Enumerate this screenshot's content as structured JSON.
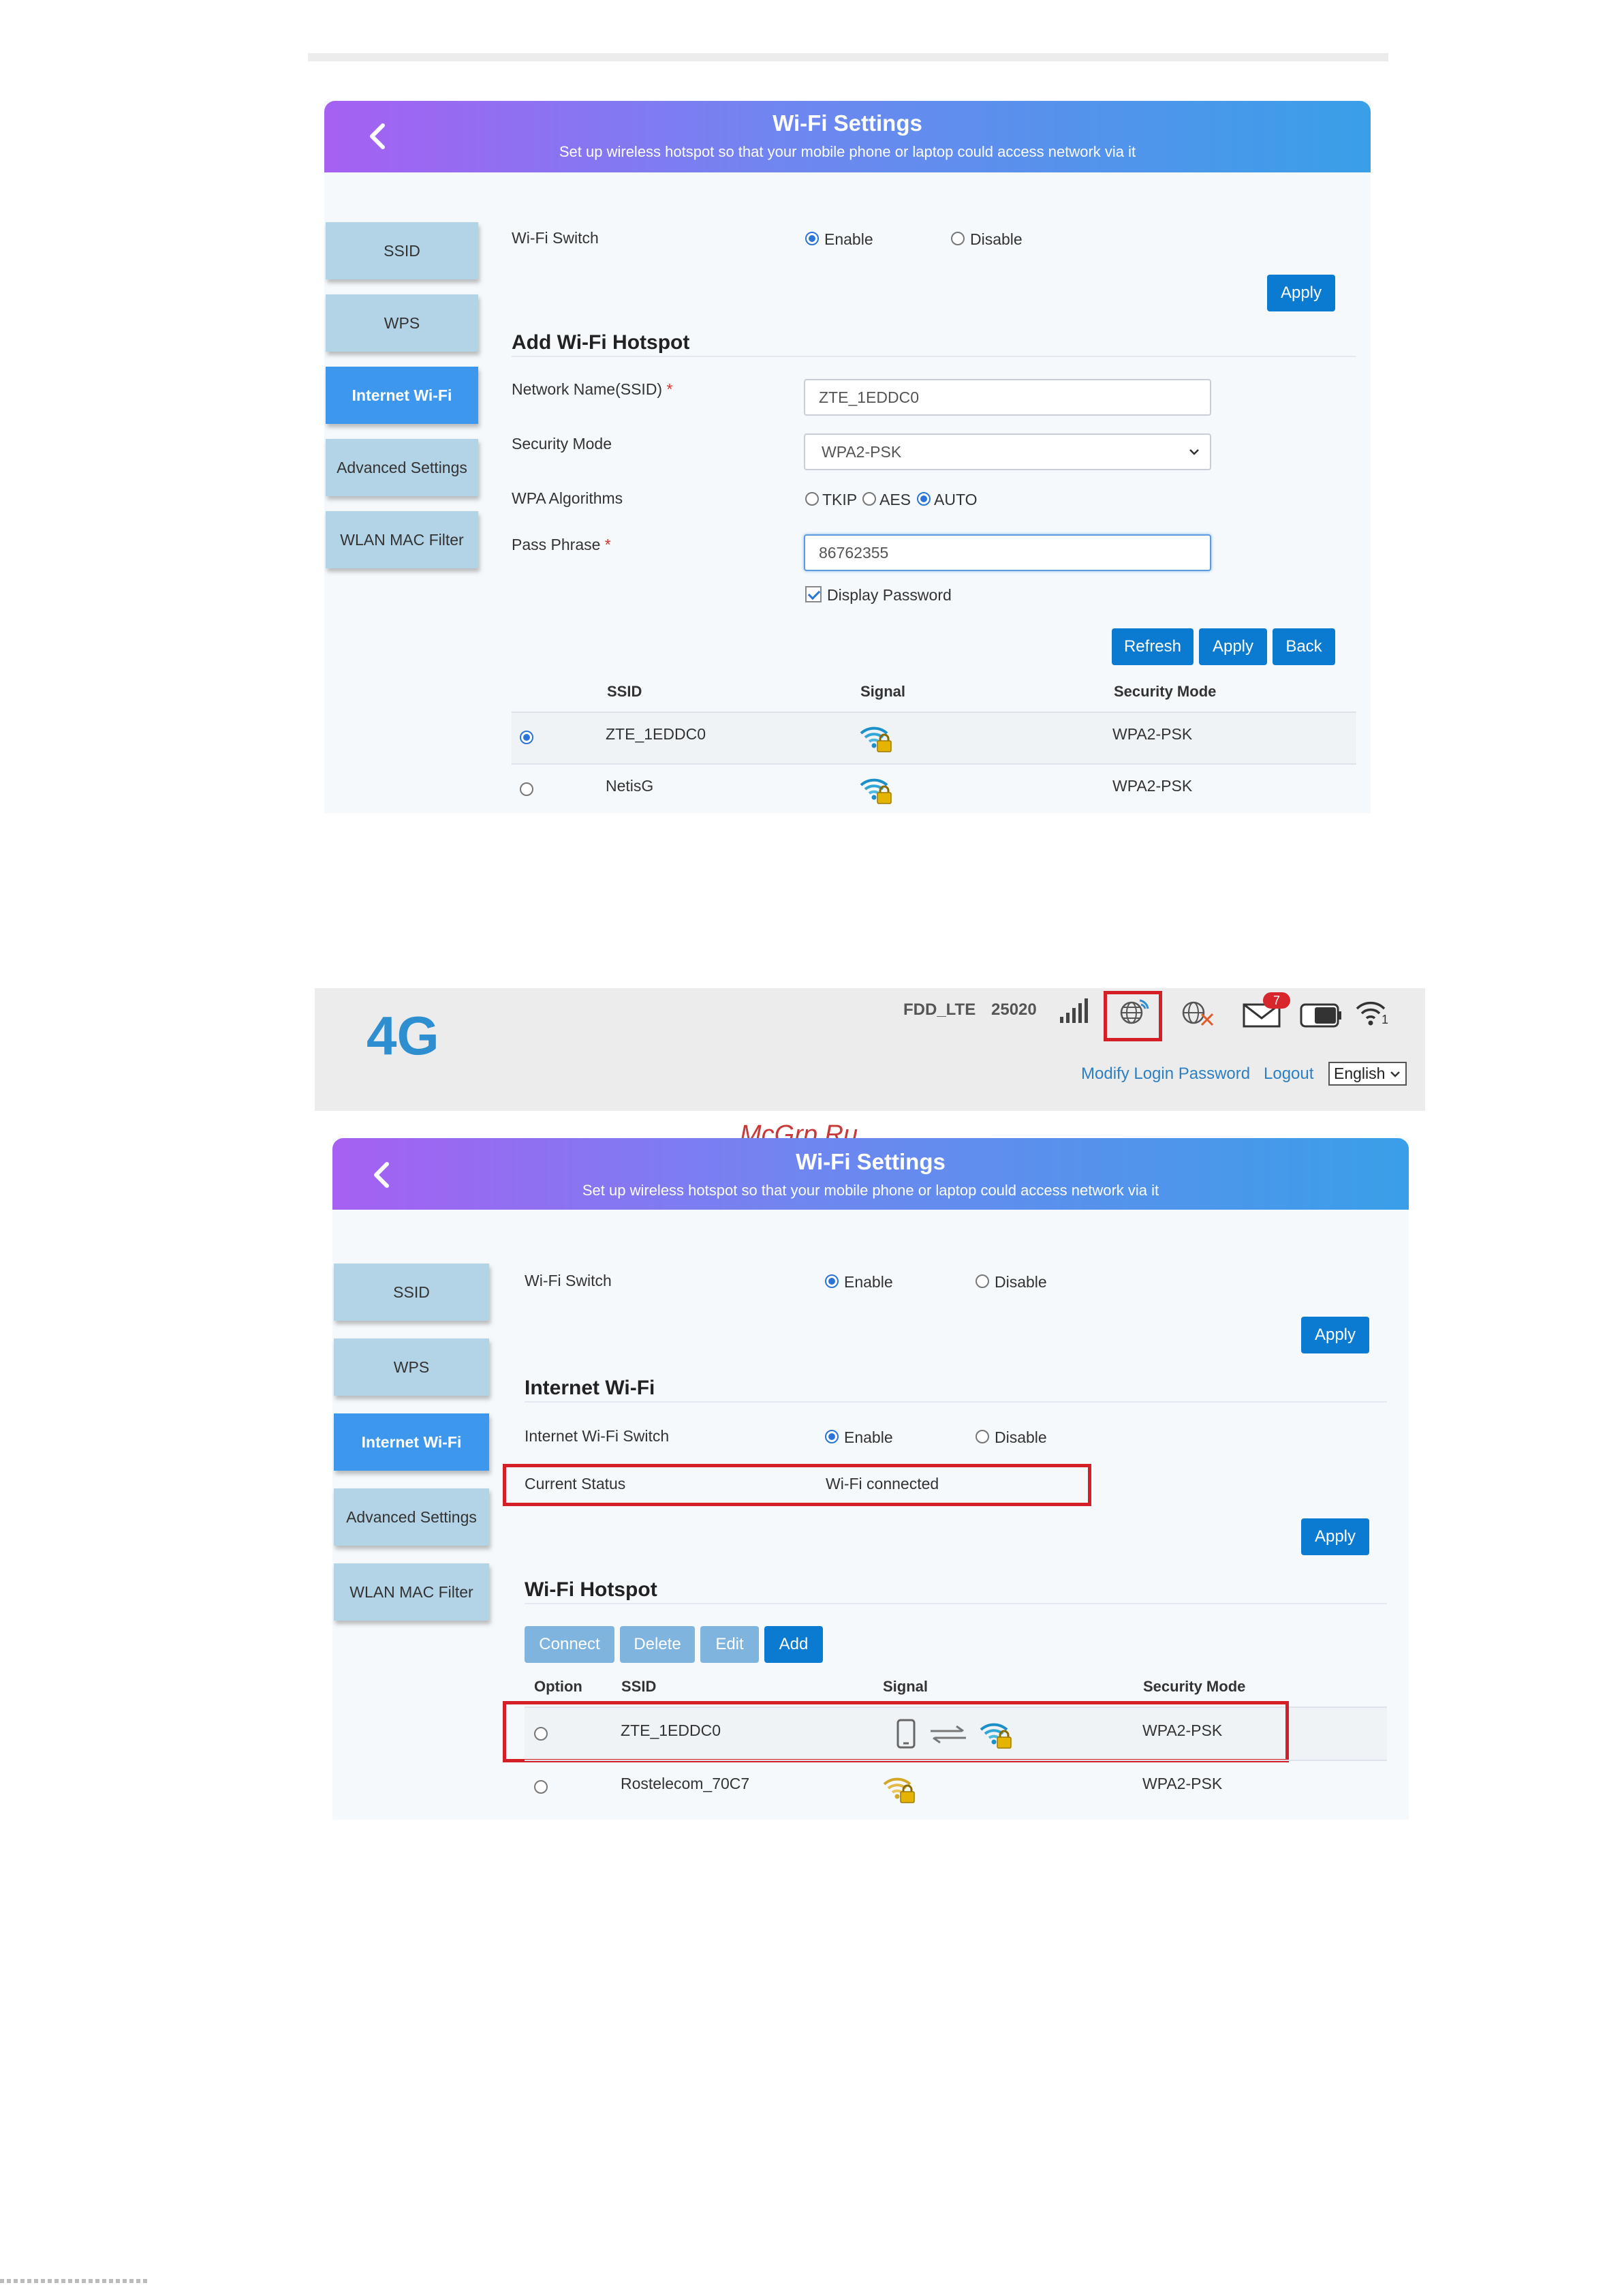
{
  "colors": {
    "accent": "#0b7ad1",
    "active_tab": "#3d97ec",
    "tab": "#b3d3e6",
    "highlight_box": "#d51f26",
    "logo": "#2d8fcf"
  },
  "panel1": {
    "title": "Wi-Fi Settings",
    "subtitle": "Set up wireless hotspot so that your mobile phone or laptop could access network via it",
    "tabs": [
      "SSID",
      "WPS",
      "Internet Wi-Fi",
      "Advanced Settings",
      "WLAN MAC Filter"
    ],
    "active_tab": "Internet Wi-Fi",
    "wifi_switch": {
      "label": "Wi-Fi Switch",
      "enable": "Enable",
      "disable": "Disable",
      "selected": "Enable"
    },
    "apply": "Apply",
    "section": "Add Wi-Fi Hotspot",
    "network_name": {
      "label": "Network Name(SSID)",
      "required": "*",
      "value": "ZTE_1EDDC0"
    },
    "security_mode": {
      "label": "Security Mode",
      "value": "WPA2-PSK"
    },
    "wpa": {
      "label": "WPA Algorithms",
      "options": [
        "TKIP",
        "AES",
        "AUTO"
      ],
      "selected": "AUTO"
    },
    "pass_phrase": {
      "label": "Pass Phrase",
      "required": "*",
      "value": "86762355"
    },
    "display_password": {
      "label": "Display Password",
      "checked": true
    },
    "buttons": {
      "refresh": "Refresh",
      "apply": "Apply",
      "back": "Back"
    },
    "table": {
      "headers": [
        "SSID",
        "Signal",
        "Security Mode"
      ],
      "rows": [
        {
          "ssid": "ZTE_1EDDC0",
          "signal": "wifi-lock-icon",
          "security": "WPA2-PSK",
          "selected": true
        },
        {
          "ssid": "NetisG",
          "signal": "wifi-lock-icon",
          "security": "WPA2-PSK",
          "selected": false
        }
      ]
    }
  },
  "statusbar": {
    "logo": "4G",
    "network_type": "FDD_LTE",
    "operator_code": "25020",
    "message_count": "7",
    "wifi_clients": "1",
    "links": {
      "modify_password": "Modify Login Password",
      "logout": "Logout"
    },
    "language": "English"
  },
  "watermark": "McGrp.Ru",
  "panel2": {
    "title": "Wi-Fi Settings",
    "subtitle": "Set up wireless hotspot so that your mobile phone or laptop could access network via it",
    "tabs": [
      "SSID",
      "WPS",
      "Internet Wi-Fi",
      "Advanced Settings",
      "WLAN MAC Filter"
    ],
    "active_tab": "Internet Wi-Fi",
    "wifi_switch": {
      "label": "Wi-Fi Switch",
      "enable": "Enable",
      "disable": "Disable",
      "selected": "Enable"
    },
    "apply": "Apply",
    "section_internet": "Internet Wi-Fi",
    "internet_switch": {
      "label": "Internet Wi-Fi Switch",
      "enable": "Enable",
      "disable": "Disable",
      "selected": "Enable"
    },
    "current_status": {
      "label": "Current Status",
      "value": "Wi-Fi connected"
    },
    "apply2": "Apply",
    "section_hotspot": "Wi-Fi Hotspot",
    "actions": {
      "connect": "Connect",
      "delete": "Delete",
      "edit": "Edit",
      "add": "Add"
    },
    "table": {
      "headers": [
        "Option",
        "SSID",
        "Signal",
        "Security Mode"
      ],
      "rows": [
        {
          "ssid": "ZTE_1EDDC0",
          "signal": "connected-wifi-lock-icon",
          "security": "WPA2-PSK"
        },
        {
          "ssid": "Rostelecom_70C7",
          "signal": "wifi-lock-icon",
          "security": "WPA2-PSK"
        }
      ]
    }
  }
}
